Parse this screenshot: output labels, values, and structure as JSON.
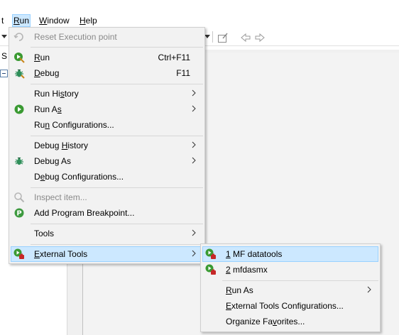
{
  "menubar": {
    "items": [
      {
        "label": "t"
      },
      {
        "label": "Run",
        "mnemonic": "R",
        "rest": "un"
      },
      {
        "label": "Window",
        "mnemonic": "W",
        "rest": "indow"
      },
      {
        "label": "Help",
        "mnemonic": "H",
        "rest": "elp"
      }
    ]
  },
  "left_panel": {
    "tab_fragment": "S"
  },
  "run_menu": {
    "reset": "Reset Execution point",
    "run": {
      "pre": "",
      "mn": "R",
      "post": "un",
      "accel": "Ctrl+F11"
    },
    "debug": {
      "pre": "",
      "mn": "D",
      "post": "ebug",
      "accel": "F11"
    },
    "run_history": {
      "pre": "Run Hi",
      "mn": "s",
      "post": "tory"
    },
    "run_as": {
      "pre": "Run A",
      "mn": "s",
      "post": ""
    },
    "run_configs": {
      "pre": "Ru",
      "mn": "n",
      "post": " Configurations..."
    },
    "debug_history": {
      "pre": "Debug ",
      "mn": "H",
      "post": "istory"
    },
    "debug_as": {
      "pre": "Debu",
      "mn": "g",
      "post": " As"
    },
    "debug_configs": {
      "pre": "D",
      "mn": "e",
      "post": "bug Configurations..."
    },
    "inspect": "Inspect item...",
    "add_breakpoint": "Add Program Breakpoint...",
    "tools": "Tools",
    "external_tools": {
      "pre": "",
      "mn": "E",
      "post": "xternal Tools"
    }
  },
  "external_tools_menu": {
    "item1": {
      "pre": "",
      "mn": "1",
      "post": " MF datatools"
    },
    "item2": {
      "pre": "",
      "mn": "2",
      "post": " mfdasmx"
    },
    "run_as": {
      "pre": "",
      "mn": "R",
      "post": "un As"
    },
    "configs": {
      "pre": "",
      "mn": "E",
      "post": "xternal Tools Configurations..."
    },
    "organize": {
      "pre": "Organize Fa",
      "mn": "v",
      "post": "orites..."
    }
  },
  "colors": {
    "highlight": "#cce8ff",
    "highlight_border": "#99d1ff",
    "run_green": "#3a9a32",
    "debug_green": "#2f8f5a"
  }
}
